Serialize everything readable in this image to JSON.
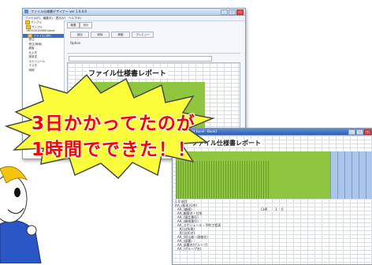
{
  "window_back": {
    "title": "ファイル仕様書デザイナー ver 1.0.0.0",
    "menu": [
      "ファイル(F)",
      "編集(E)",
      "表示(V)",
      "ヘルプ(H)"
    ],
    "tabs": [
      "概要",
      "設計"
    ],
    "toolbar": [
      "追加",
      "削除",
      "移動",
      "プレビュー"
    ],
    "options_label": "Option",
    "sheet_title": "ファイル仕様書レポート",
    "tree": [
      "サンプル",
      "サンプル",
      "MFIS001058M.sheet",
      "ファイル(3件)",
      "受注",
      "受注(明細)",
      "顧客",
      "仕入先",
      "請求書",
      "スケジュール",
      "マスタ",
      "明細"
    ]
  },
  "window_front": {
    "title": "Microsoft Excel - Book1",
    "sheet_title": "ファイル仕様書レポート",
    "rows": [
      "1.0 項目",
      "AA_(基本)(1件)",
      "AA_(顧客)",
      "AA_顧客名・住所",
      "AA_(電話番号)",
      "AA_(郵便番号)",
      "AA_スケジュール・予約工程表",
      "担当(所属)",
      "担当(氏名)",
      "AA_(担当者・連絡先)",
      "AA_(部署)",
      "AA_部署名(グループ)",
      "AA_(グループ名)"
    ],
    "row_values": [
      "CHR",
      "1",
      "0"
    ]
  },
  "banner": {
    "line1": "3日かかってたのが",
    "line2": "1時間でできた！！"
  }
}
